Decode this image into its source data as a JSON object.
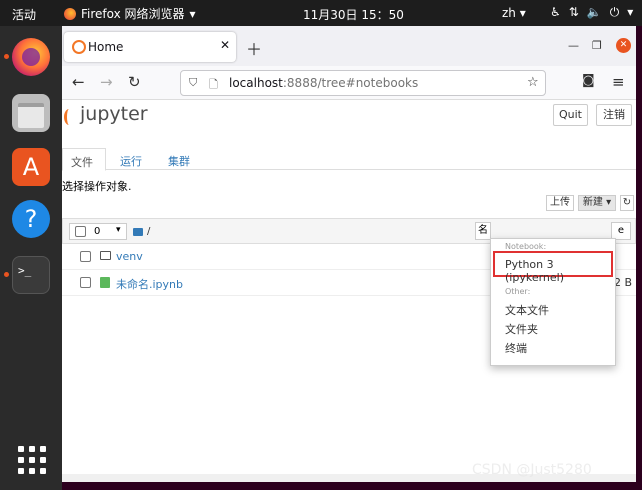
{
  "system": {
    "activities": "活动",
    "app_name": "Firefox 网络浏览器",
    "clock": "11月30日  15：50",
    "lang": "zh"
  },
  "browser": {
    "tab_title": "Home",
    "url_host": "localhost",
    "url_rest": ":8888/tree#notebooks"
  },
  "jupyter": {
    "logo": "jupyter",
    "quit_label": "Quit",
    "logout_label": "注销",
    "tabs": [
      "文件",
      "运行",
      "集群"
    ],
    "hint": "选择操作对象.",
    "upload_label": "上传",
    "new_label": "新建",
    "selected_count": "0",
    "breadcrumb": "/",
    "sort_name": "名",
    "sort_size_tail": "e",
    "files": [
      {
        "name": "venv",
        "size": ""
      },
      {
        "name": "未命名.ipynb",
        "size": "2 B"
      }
    ]
  },
  "dropdown": {
    "notebook_header": "Notebook:",
    "python_kernel": "Python 3 (ipykernel)",
    "other_header": "Other:",
    "text_file": "文本文件",
    "folder": "文件夹",
    "terminal": "终端"
  },
  "watermark": "CSDN @Just5280"
}
